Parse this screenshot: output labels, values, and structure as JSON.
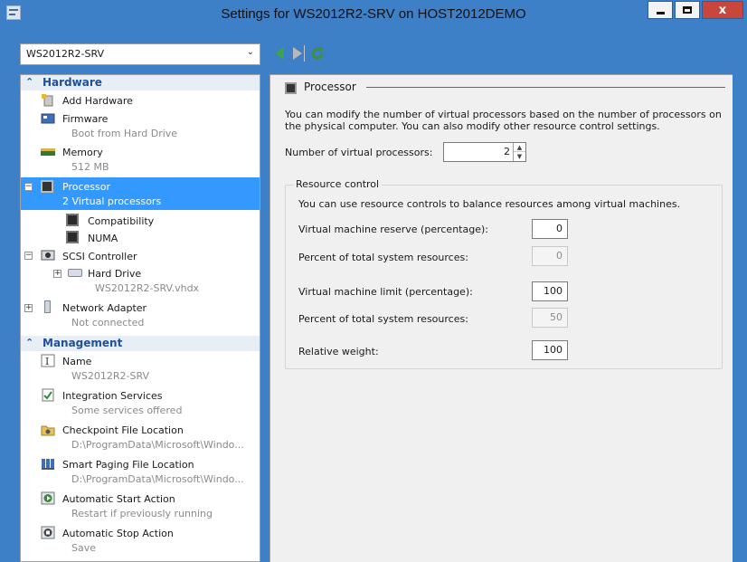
{
  "window": {
    "title": "Settings for WS2012R2-SRV on HOST2012DEMO",
    "close_glyph": "x"
  },
  "vm_selector": {
    "value": "WS2012R2-SRV"
  },
  "tree": {
    "hardware_header": "Hardware",
    "management_header": "Management",
    "items": {
      "add_hardware": "Add Hardware",
      "firmware": "Firmware",
      "firmware_sub": "Boot from Hard Drive",
      "memory": "Memory",
      "memory_sub": "512 MB",
      "processor": "Processor",
      "processor_sub": "2 Virtual processors",
      "compatibility": "Compatibility",
      "numa": "NUMA",
      "scsi": "SCSI Controller",
      "hard_drive": "Hard Drive",
      "hard_drive_sub": "WS2012R2-SRV.vhdx",
      "network": "Network Adapter",
      "network_sub": "Not connected",
      "name": "Name",
      "name_sub": "WS2012R2-SRV",
      "integration": "Integration Services",
      "integration_sub": "Some services offered",
      "checkpoint": "Checkpoint File Location",
      "checkpoint_sub": "D:\\ProgramData\\Microsoft\\Windo...",
      "paging": "Smart Paging File Location",
      "paging_sub": "D:\\ProgramData\\Microsoft\\Windo...",
      "auto_start": "Automatic Start Action",
      "auto_start_sub": "Restart if previously running",
      "auto_stop": "Automatic Stop Action",
      "auto_stop_sub": "Save"
    }
  },
  "pane": {
    "title": "Processor",
    "description": "You can modify the number of virtual processors based on the number of processors on the physical computer. You can also modify other resource control settings.",
    "nvp_label": "Number of virtual processors:",
    "nvp_value": "2",
    "resource_control": {
      "title": "Resource control",
      "description": "You can use resource controls to balance resources among virtual machines.",
      "reserve_label": "Virtual machine reserve (percentage):",
      "reserve_value": "0",
      "reserve_total_label": "Percent of total system resources:",
      "reserve_total_value": "0",
      "limit_label": "Virtual machine limit (percentage):",
      "limit_value": "100",
      "limit_total_label": "Percent of total system resources:",
      "limit_total_value": "50",
      "weight_label": "Relative weight:",
      "weight_value": "100"
    }
  },
  "colors": {
    "title_bar": "#3d80c8",
    "selection": "#3399ff",
    "section_header_text": "#1e4f99",
    "close_button": "#c9463d"
  }
}
